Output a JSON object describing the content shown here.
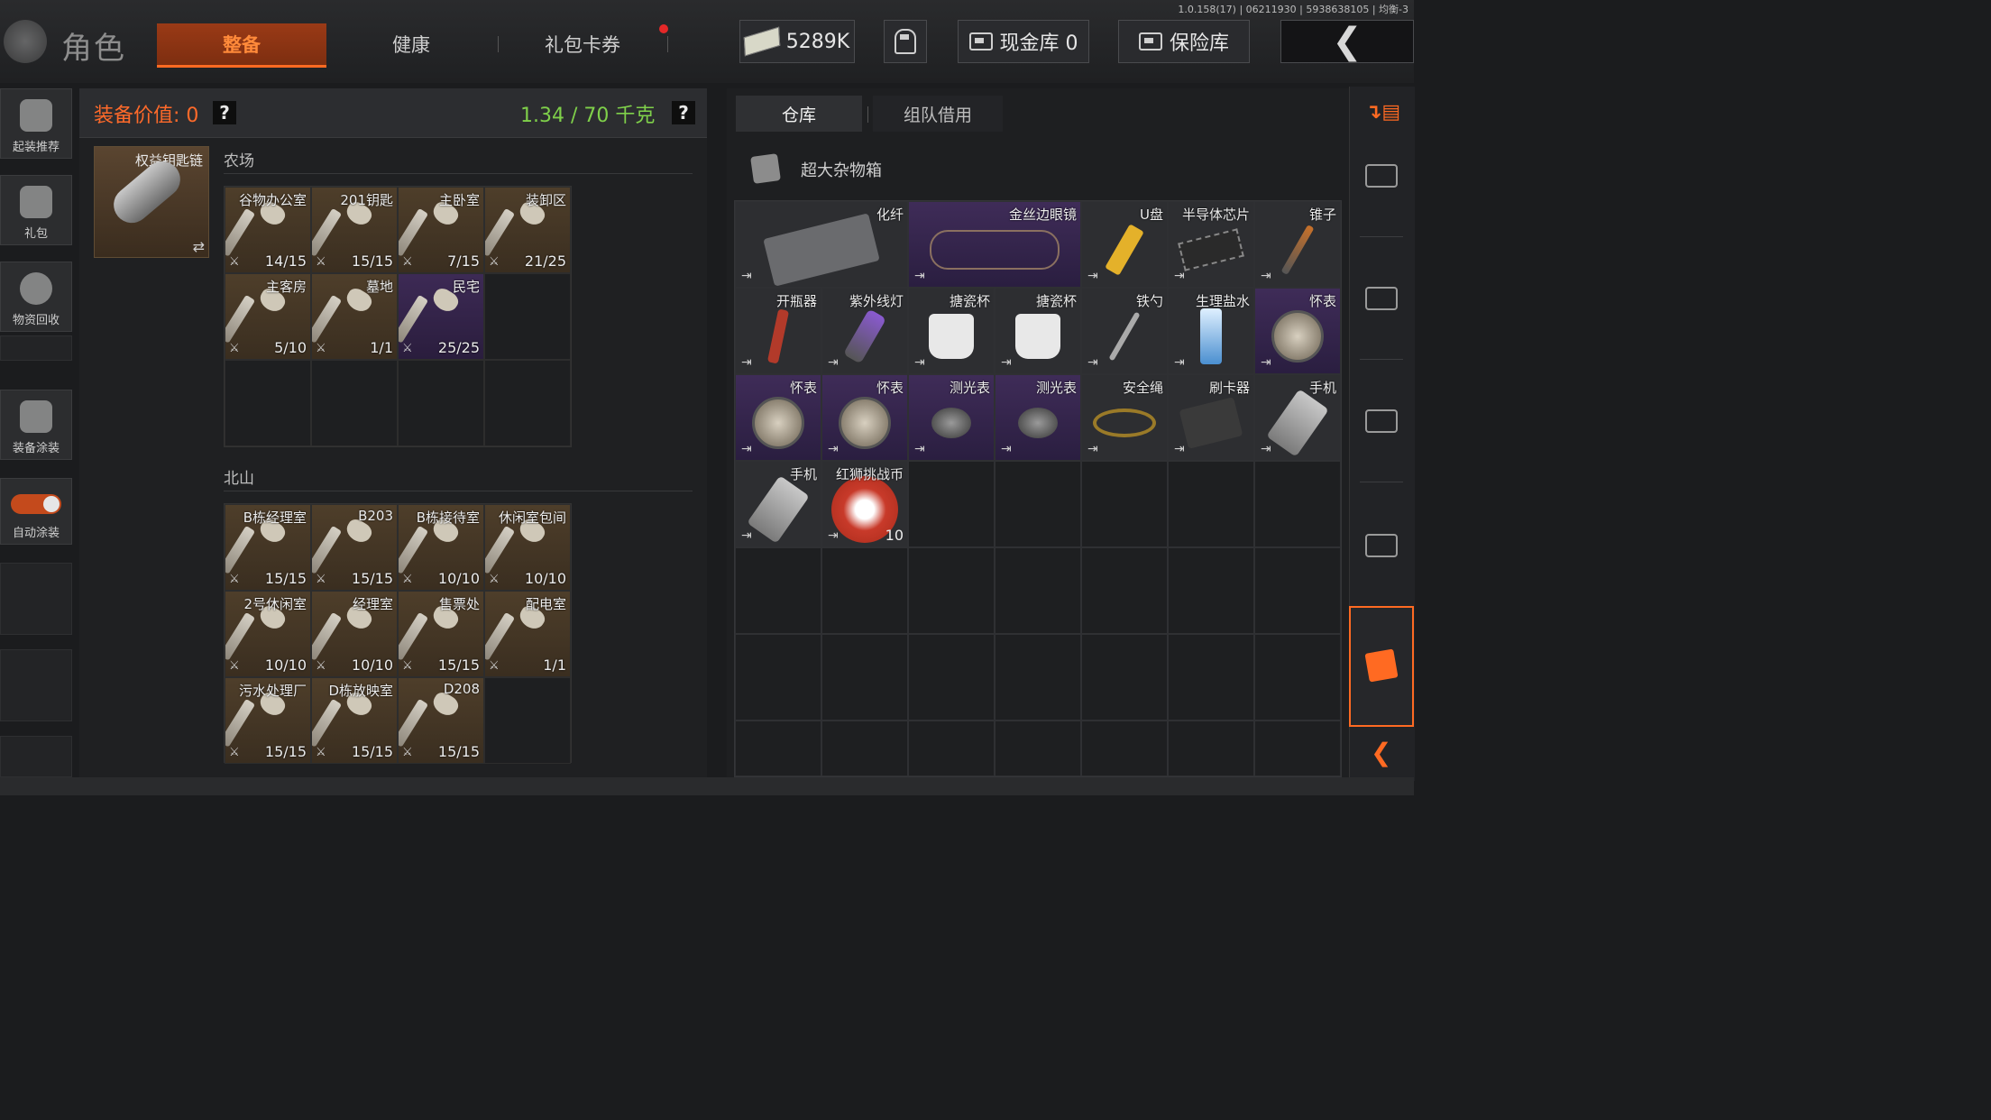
{
  "version": "1.0.158(17) | 06211930 | 5938638105 | 均衡-3",
  "header": {
    "title": "角色",
    "tabs": [
      {
        "label": "整备",
        "active": true
      },
      {
        "label": "健康",
        "active": false
      },
      {
        "label": "礼包卡券",
        "active": false,
        "badge": true
      }
    ],
    "cash": "5289K",
    "cash_vault": "现金库 0",
    "safe_box": "保险库"
  },
  "sidebar": {
    "items": [
      {
        "label": "起装推荐",
        "icon": "helmet-loadout-icon"
      },
      {
        "label": "礼包",
        "icon": "gift-icon"
      },
      {
        "label": "物资回收",
        "icon": "recycle-icon"
      },
      {
        "label": "装备涂装",
        "icon": "paint-helmet-icon"
      },
      {
        "label": "自动涂装",
        "toggle": true
      }
    ]
  },
  "equipment": {
    "value_label": "装备价值: 0",
    "weight": "1.34 / 70 千克",
    "keychain_label": "权益钥匙链",
    "help": "?"
  },
  "farm": {
    "title": "农场",
    "keys": [
      {
        "name": "谷物办公室",
        "count": "14/15",
        "rarity": "gold"
      },
      {
        "name": "201钥匙",
        "count": "15/15",
        "rarity": "gold"
      },
      {
        "name": "主卧室",
        "count": "7/15",
        "rarity": "gold"
      },
      {
        "name": "装卸区",
        "count": "21/25",
        "rarity": "gold"
      },
      {
        "name": "主客房",
        "count": "5/10",
        "rarity": "gold"
      },
      {
        "name": "墓地",
        "count": "1/1",
        "rarity": "gold"
      },
      {
        "name": "民宅",
        "count": "25/25",
        "rarity": "purple"
      }
    ]
  },
  "north": {
    "title": "北山",
    "keys": [
      {
        "name": "B栋经理室",
        "count": "15/15",
        "rarity": "gold"
      },
      {
        "name": "B203",
        "count": "15/15",
        "rarity": "gold"
      },
      {
        "name": "B栋接待室",
        "count": "10/10",
        "rarity": "gold"
      },
      {
        "name": "休闲室包间",
        "count": "10/10",
        "rarity": "gold"
      },
      {
        "name": "2号休闲室",
        "count": "10/10",
        "rarity": "gold"
      },
      {
        "name": "经理室",
        "count": "10/10",
        "rarity": "gold"
      },
      {
        "name": "售票处",
        "count": "15/15",
        "rarity": "gold"
      },
      {
        "name": "配电室",
        "count": "1/1",
        "rarity": "gold"
      },
      {
        "name": "污水处理厂",
        "count": "15/15",
        "rarity": "gold"
      },
      {
        "name": "D栋放映室",
        "count": "15/15",
        "rarity": "gold"
      },
      {
        "name": "D208",
        "count": "15/15",
        "rarity": "gold"
      }
    ]
  },
  "storage": {
    "tabs": [
      {
        "label": "仓库",
        "active": true
      },
      {
        "label": "组队借用",
        "active": false
      }
    ],
    "box_label": "超大杂物箱",
    "items": [
      {
        "name": "化纤",
        "rarity": "gray",
        "span": 2,
        "icon": "fabric-icon"
      },
      {
        "name": "金丝边眼镜",
        "rarity": "purple",
        "span": 2,
        "icon": "glasses-icon"
      },
      {
        "name": "U盘",
        "rarity": "gray",
        "icon": "usb-icon"
      },
      {
        "name": "半导体芯片",
        "rarity": "gray",
        "icon": "chip-icon"
      },
      {
        "name": "锥子",
        "rarity": "gray",
        "icon": "awl-icon"
      },
      {
        "name": "开瓶器",
        "rarity": "gray",
        "icon": "opener-icon"
      },
      {
        "name": "紫外线灯",
        "rarity": "gray",
        "icon": "uv-lamp-icon"
      },
      {
        "name": "搪瓷杯",
        "rarity": "gray",
        "icon": "mug-icon"
      },
      {
        "name": "搪瓷杯",
        "rarity": "gray",
        "icon": "mug-icon"
      },
      {
        "name": "铁勺",
        "rarity": "gray",
        "icon": "spoon-icon"
      },
      {
        "name": "生理盐水",
        "rarity": "gray",
        "icon": "saline-icon"
      },
      {
        "name": "怀表",
        "rarity": "purple",
        "icon": "pocket-watch-icon"
      },
      {
        "name": "怀表",
        "rarity": "purple",
        "icon": "pocket-watch-icon"
      },
      {
        "name": "怀表",
        "rarity": "purple",
        "icon": "pocket-watch-icon"
      },
      {
        "name": "测光表",
        "rarity": "purple",
        "icon": "light-meter-icon"
      },
      {
        "name": "测光表",
        "rarity": "purple",
        "icon": "light-meter-icon"
      },
      {
        "name": "安全绳",
        "rarity": "gray",
        "icon": "rope-icon"
      },
      {
        "name": "刷卡器",
        "rarity": "gray",
        "icon": "card-reader-icon"
      },
      {
        "name": "手机",
        "rarity": "gray",
        "icon": "phone-icon"
      },
      {
        "name": "手机",
        "rarity": "gray",
        "icon": "phone-icon"
      },
      {
        "name": "红狮挑战币",
        "rarity": "gray",
        "count": "10",
        "icon": "coin-icon"
      }
    ]
  },
  "colors": {
    "accent": "#ff6a22",
    "weight_green": "#7fd04a",
    "gold_bg": "#4e3e2a",
    "purple_bg": "#3d2a55"
  }
}
